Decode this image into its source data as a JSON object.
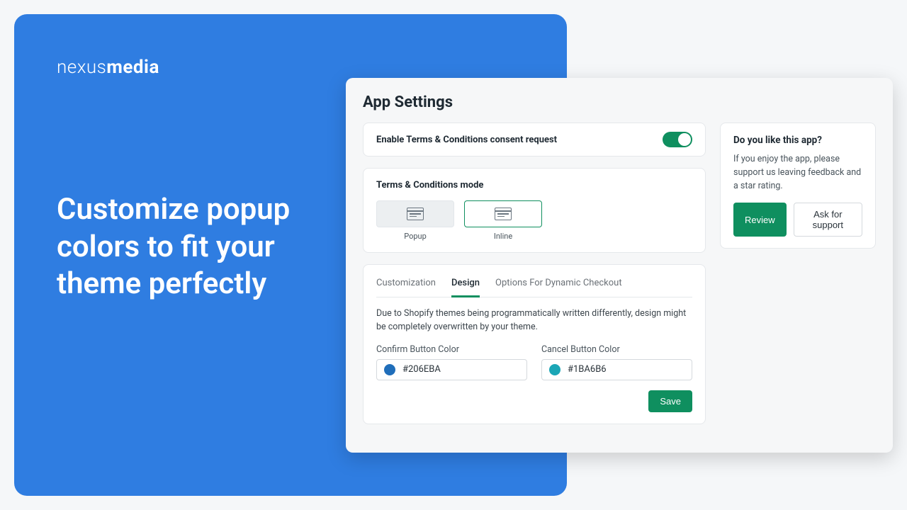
{
  "promo": {
    "logo_thin": "nexus",
    "logo_bold": "media",
    "headline": "Customize popup colors to fit your theme perfectly"
  },
  "settings": {
    "title": "App Settings",
    "enable_label": "Enable Terms & Conditions consent request",
    "enable_on": true,
    "mode": {
      "title": "Terms & Conditions mode",
      "options": [
        {
          "label": "Popup",
          "selected": false
        },
        {
          "label": "Inline",
          "selected": true
        }
      ]
    },
    "tabs": [
      {
        "label": "Customization",
        "active": false
      },
      {
        "label": "Design",
        "active": true
      },
      {
        "label": "Options For Dynamic Checkout",
        "active": false
      }
    ],
    "design": {
      "note": "Due to Shopify themes being programmatically written differently, design might be completely overwritten by your theme.",
      "confirm_label": "Confirm Button Color",
      "confirm_color": "#206EBA",
      "cancel_label": "Cancel Button Color",
      "cancel_color": "#1BA6B6",
      "save_label": "Save"
    }
  },
  "feedback": {
    "title": "Do you like this app?",
    "text": "If you enjoy the app, please support us leaving feedback and a star rating.",
    "review_label": "Review",
    "support_label": "Ask for support"
  }
}
